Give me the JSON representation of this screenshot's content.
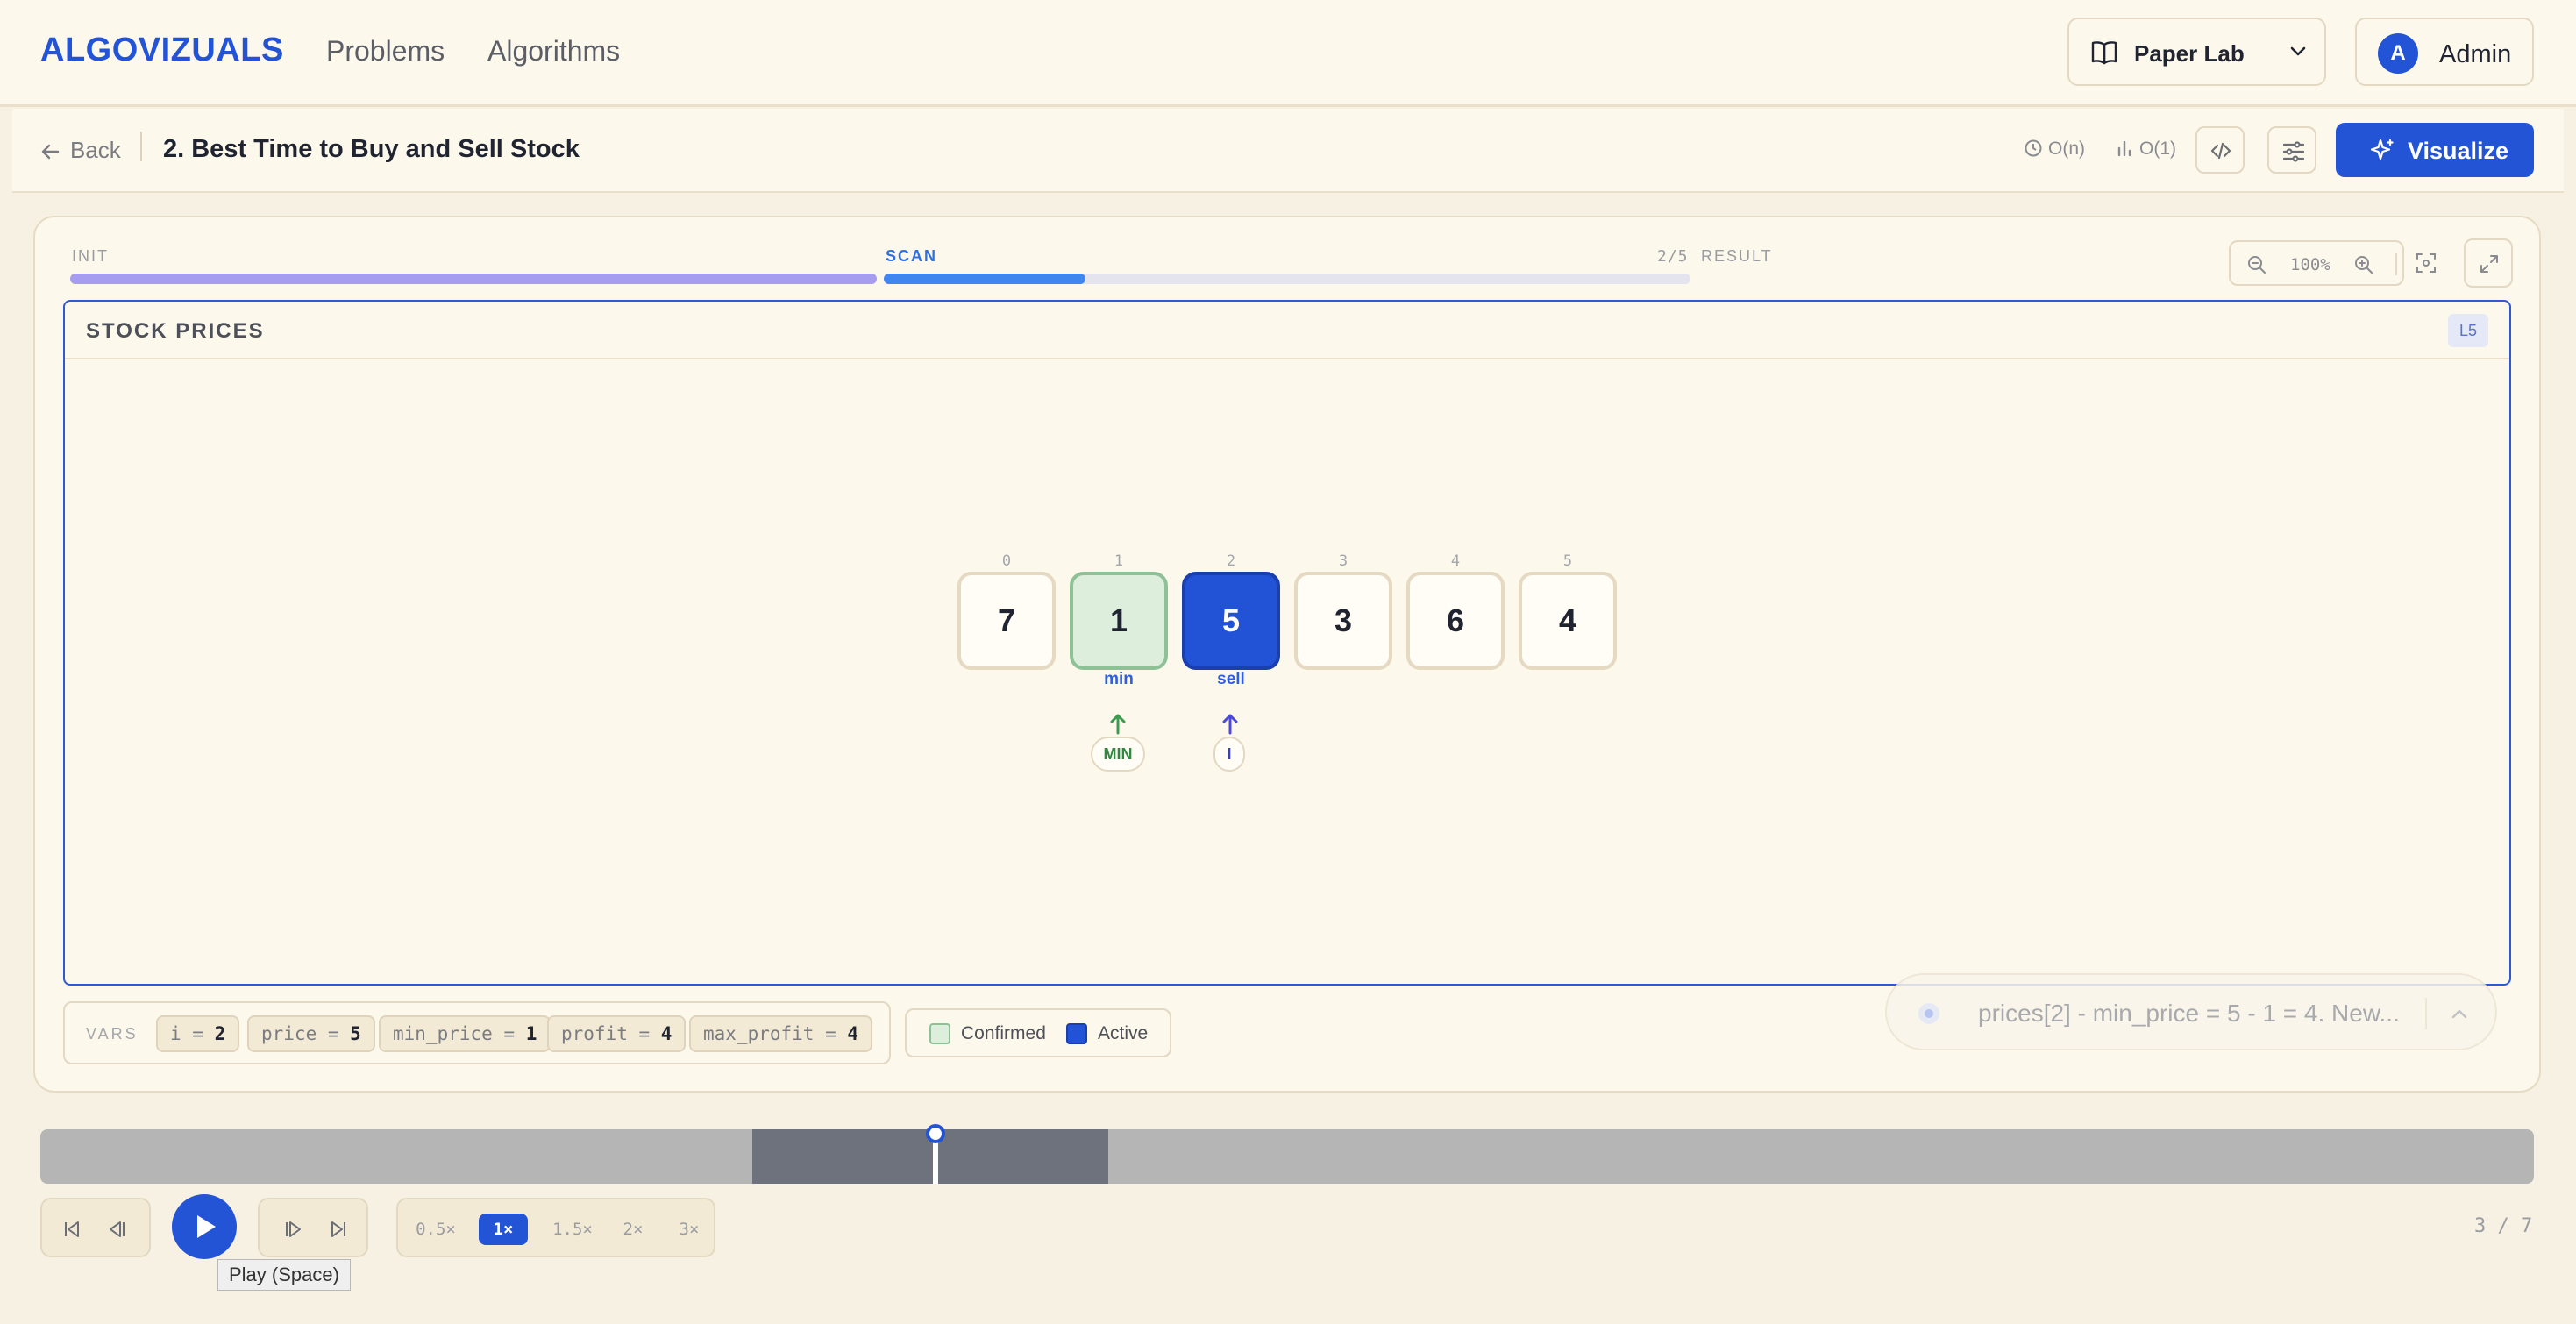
{
  "nav": {
    "brand": "ALGOVIZUALS",
    "links": [
      "Problems",
      "Algorithms"
    ],
    "lab_select": "Paper Lab",
    "user_initial": "A",
    "user_name": "Admin"
  },
  "toolbar": {
    "back": "Back",
    "title": "2. Best Time to Buy and Sell Stock",
    "time_complexity": "O(n)",
    "space_complexity": "O(1)",
    "visualize": "Visualize"
  },
  "phases": {
    "items": [
      "INIT",
      "SCAN",
      "RESULT"
    ],
    "count": "2/5",
    "scan_progress": 0.25
  },
  "zoom": {
    "level": "100%"
  },
  "panel": {
    "title": "STOCK PRICES",
    "level_badge": "L5",
    "cells": [
      {
        "index": "0",
        "value": "7",
        "state": "default",
        "label": ""
      },
      {
        "index": "1",
        "value": "1",
        "state": "confirmed",
        "label": "min"
      },
      {
        "index": "2",
        "value": "5",
        "state": "active",
        "label": "sell"
      },
      {
        "index": "3",
        "value": "3",
        "state": "default",
        "label": ""
      },
      {
        "index": "4",
        "value": "6",
        "state": "default",
        "label": ""
      },
      {
        "index": "5",
        "value": "4",
        "state": "default",
        "label": ""
      }
    ],
    "pointers": {
      "min": "MIN",
      "i": "I"
    }
  },
  "vars": {
    "heading": "VARS",
    "items": [
      {
        "name": "i",
        "value": "2"
      },
      {
        "name": "price",
        "value": "5"
      },
      {
        "name": "min_price",
        "value": "1"
      },
      {
        "name": "profit",
        "value": "4"
      },
      {
        "name": "max_profit",
        "value": "4"
      }
    ]
  },
  "legend": {
    "confirmed": "Confirmed",
    "active": "Active"
  },
  "toast": {
    "message": "prices[2] - min_price = 5 - 1 = 4. New..."
  },
  "playback": {
    "tooltip": "Play (Space)",
    "speeds": [
      "0.5×",
      "1×",
      "1.5×",
      "2×",
      "3×"
    ],
    "selected_speed": "1×",
    "step": "3 / 7"
  },
  "colors": {
    "accent": "#2354d6",
    "confirmed": "#ddeedd",
    "active": "#2253d6",
    "background": "#f7f1e3"
  }
}
